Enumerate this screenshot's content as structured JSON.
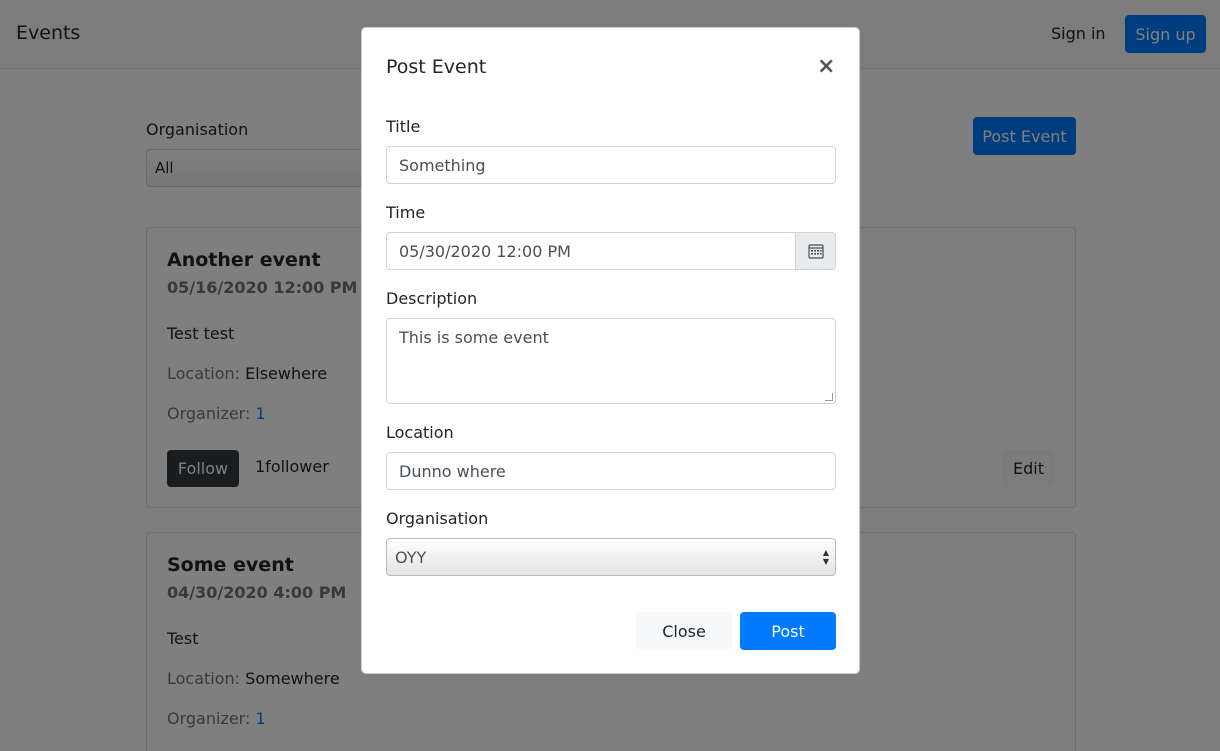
{
  "navbar": {
    "brand": "Events",
    "signin_label": "Sign in",
    "signup_label": "Sign up"
  },
  "filters": {
    "organisation_label": "Organisation",
    "organisation_value": "All"
  },
  "post_event_button": "Post Event",
  "events": [
    {
      "title": "Another event",
      "time": "05/16/2020 12:00 PM",
      "description": "Test test",
      "location_label": "Location:",
      "location": "Elsewhere",
      "organizer_label": "Organizer:",
      "organizer": "1",
      "follow_label": "Follow",
      "followers": "1follower",
      "edit_label": "Edit"
    },
    {
      "title": "Some event",
      "time": "04/30/2020 4:00 PM",
      "description": "Test",
      "location_label": "Location:",
      "location": "Somewhere",
      "organizer_label": "Organizer:",
      "organizer": "1"
    }
  ],
  "modal": {
    "title": "Post Event",
    "close_glyph": "×",
    "fields": {
      "title_label": "Title",
      "title_value": "Something",
      "time_label": "Time",
      "time_value": "05/30/2020 12:00 PM",
      "description_label": "Description",
      "description_value": "This is some event",
      "location_label": "Location",
      "location_value": "Dunno where",
      "organisation_label": "Organisation",
      "organisation_value": "OYY"
    },
    "close_button": "Close",
    "post_button": "Post"
  },
  "colors": {
    "primary": "#007bff",
    "dark": "#343a40",
    "light": "#f8f9fa"
  },
  "icons": {
    "calendar": "calendar-icon",
    "close": "close-icon"
  }
}
